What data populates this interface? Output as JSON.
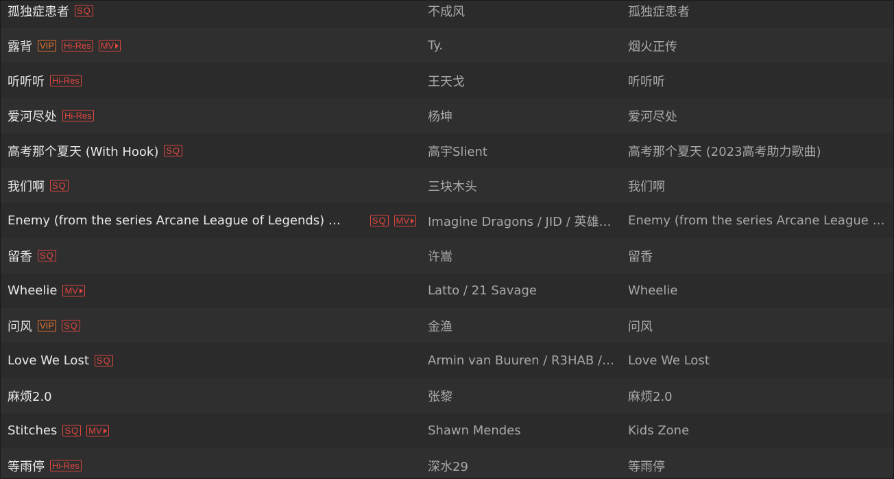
{
  "songs": [
    {
      "title": "孤独症患者",
      "badges": [
        "SQ"
      ],
      "artist": "不成风",
      "album": "孤独症患者"
    },
    {
      "title": "露背",
      "badges": [
        "VIP",
        "Hi-Res",
        "MV"
      ],
      "artist": "Ty.",
      "album": "烟火正传"
    },
    {
      "title": "听听听",
      "badges": [
        "Hi-Res"
      ],
      "artist": "王天戈",
      "album": "听听听"
    },
    {
      "title": "爱河尽处",
      "badges": [
        "Hi-Res"
      ],
      "artist": "杨坤",
      "album": "爱河尽处"
    },
    {
      "title": "高考那个夏天 (With Hook)",
      "badges": [
        "SQ"
      ],
      "artist": "高宇Slient",
      "album": "高考那个夏天 (2023高考助力歌曲)"
    },
    {
      "title": "我们啊",
      "badges": [
        "SQ"
      ],
      "artist": "三块木头",
      "album": "我们啊"
    },
    {
      "title": "Enemy (from the series Arcane League of Legends) (…",
      "badges": [
        "SQ",
        "MV"
      ],
      "artist": "Imagine Dragons / JID / 英雄…",
      "album": "Enemy (from the series Arcane League o…"
    },
    {
      "title": "留香",
      "badges": [
        "SQ"
      ],
      "artist": "许嵩",
      "album": "留香"
    },
    {
      "title": "Wheelie",
      "badges": [
        "MV"
      ],
      "artist": "Latto / 21 Savage",
      "album": "Wheelie"
    },
    {
      "title": "问风",
      "badges": [
        "VIP",
        "SQ"
      ],
      "artist": "金渔",
      "album": "问风"
    },
    {
      "title": "Love We Lost",
      "badges": [
        "SQ"
      ],
      "artist": "Armin van Buuren / R3HAB / …",
      "album": "Love We Lost"
    },
    {
      "title": "麻烦2.0",
      "badges": [],
      "artist": "张黎",
      "album": "麻烦2.0"
    },
    {
      "title": "Stitches",
      "badges": [
        "SQ",
        "MV"
      ],
      "artist": "Shawn Mendes",
      "album": "Kids Zone"
    },
    {
      "title": "等雨停",
      "badges": [
        "Hi-Res"
      ],
      "artist": "深水29",
      "album": "等雨停"
    }
  ],
  "badge_labels": {
    "SQ": "SQ",
    "VIP": "VIP",
    "Hi-Res": "Hi-Res",
    "MV": "MV"
  },
  "colors": {
    "background": "#2b2b2b",
    "row_alt": "#2f2f2f",
    "badge_red": "#e0463f",
    "badge_orange": "#e8762d",
    "title_text": "#e8e8e8",
    "secondary_text": "#a9a9a9"
  }
}
